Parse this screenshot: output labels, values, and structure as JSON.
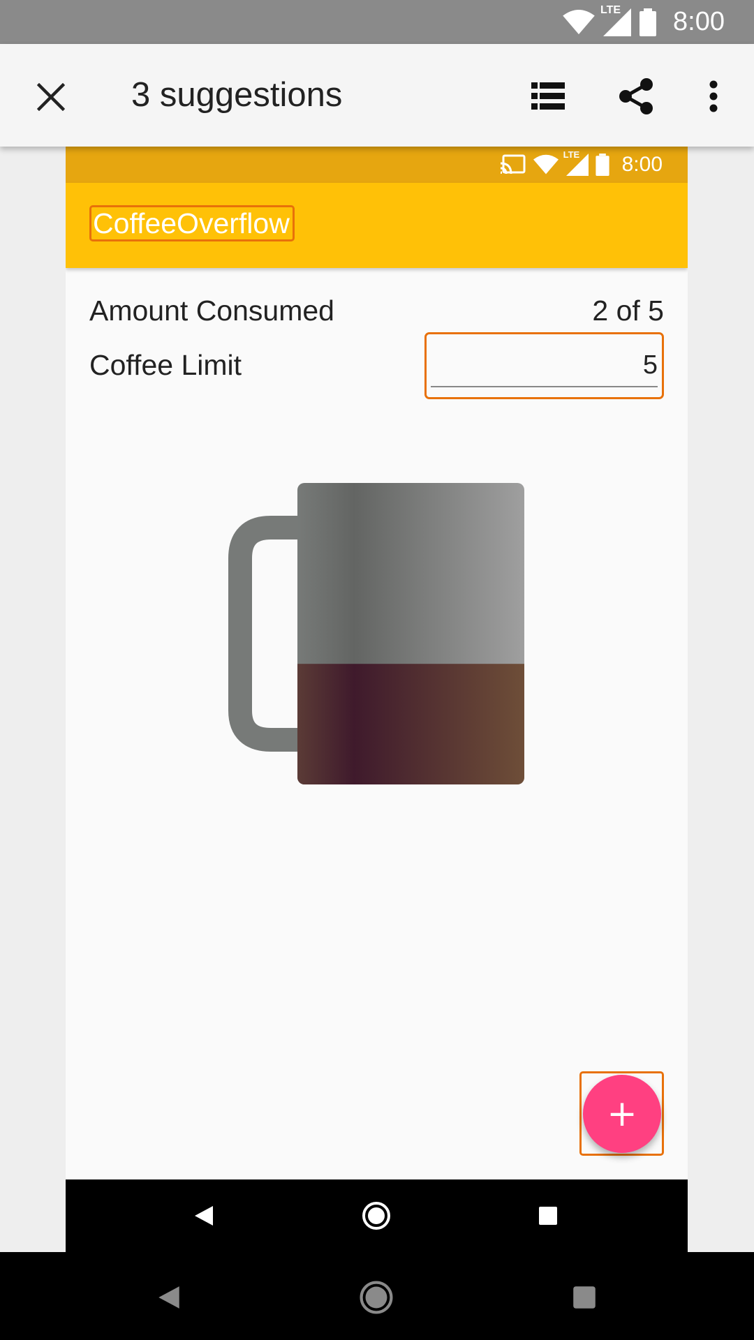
{
  "device_status": {
    "time": "8:00",
    "network": "LTE"
  },
  "scanner_toolbar": {
    "title": "3 suggestions",
    "close_icon": "close-icon",
    "list_icon": "list-icon",
    "share_icon": "share-icon",
    "more_icon": "more-vert-icon"
  },
  "app": {
    "status": {
      "time": "8:00",
      "network": "LTE"
    },
    "title": "CoffeeOverflow",
    "amount_label": "Amount Consumed",
    "amount_value": "2 of 5",
    "limit_label": "Coffee Limit",
    "limit_value": "5",
    "fab_label": "+",
    "fill_level": 0.4,
    "colors": {
      "app_bar": "#ffc107",
      "status_bar": "#e6a610",
      "fab": "#ff4081",
      "highlight": "#e8710a"
    }
  }
}
